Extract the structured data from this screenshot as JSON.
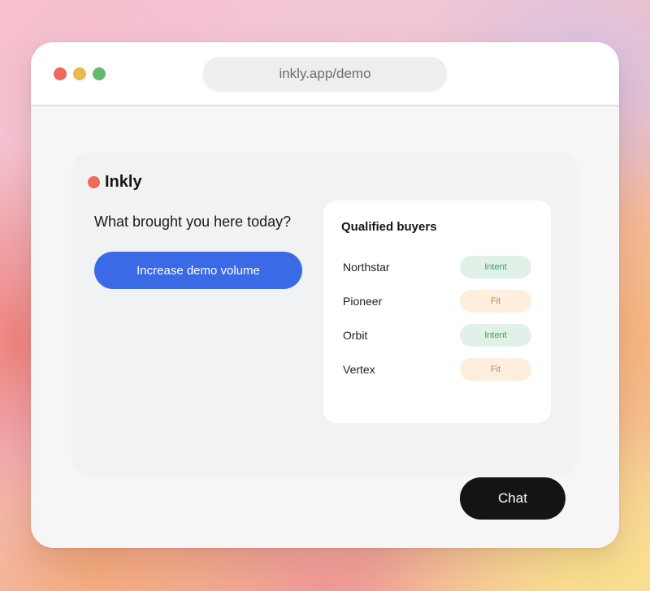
{
  "browser": {
    "url": "inkly.app/demo"
  },
  "brand": {
    "name": "Inkly"
  },
  "prompt": {
    "question": "What brought you here today?",
    "answer_label": "Increase demo volume"
  },
  "buyers": {
    "title": "Qualified buyers",
    "rows": [
      {
        "name": "Northstar",
        "tag": "Intent"
      },
      {
        "name": "Pioneer",
        "tag": "Fit"
      },
      {
        "name": "Orbit",
        "tag": "Intent"
      },
      {
        "name": "Vertex",
        "tag": "Fit"
      }
    ]
  },
  "chat": {
    "label": "Chat"
  },
  "colors": {
    "primary_button": "#3a6ae6",
    "brand_dot": "#ef6a57",
    "intent_tag_bg": "#e0f2e7",
    "fit_tag_bg": "#fdeedd",
    "chat_button": "#141414"
  }
}
